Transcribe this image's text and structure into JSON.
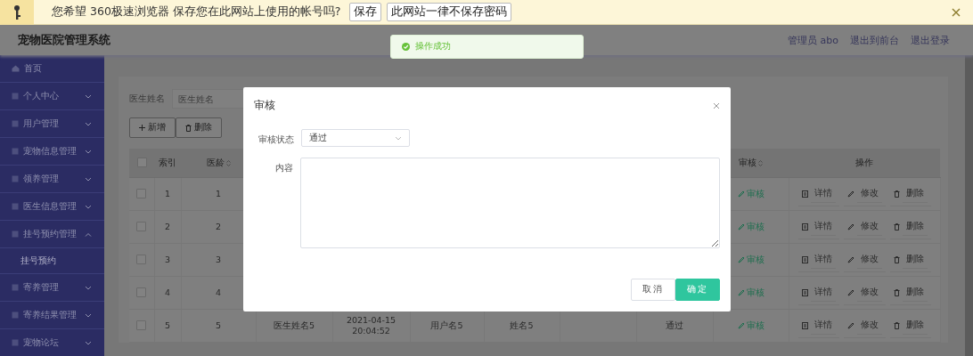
{
  "password_bar": {
    "message": "您希望 360极速浏览器 保存您在此网站上使用的帐号吗?",
    "buttons": [
      "保存",
      "此网站一律不保存密码"
    ]
  },
  "header": {
    "title": "宠物医院管理系统",
    "links": [
      "管理员 abo",
      "退出到前台",
      "退出登录"
    ]
  },
  "toast": {
    "message": "操作成功"
  },
  "sidebar": {
    "items": [
      {
        "label": "首页",
        "kind": "link"
      },
      {
        "label": "个人中心",
        "kind": "group",
        "expanded": false
      },
      {
        "label": "用户管理",
        "kind": "group",
        "expanded": false
      },
      {
        "label": "宠物信息管理",
        "kind": "group",
        "expanded": false
      },
      {
        "label": "领养管理",
        "kind": "group",
        "expanded": false
      },
      {
        "label": "医生信息管理",
        "kind": "group",
        "expanded": false
      },
      {
        "label": "挂号预约管理",
        "kind": "group",
        "expanded": true,
        "children": [
          {
            "label": "挂号预约"
          }
        ]
      },
      {
        "label": "寄养管理",
        "kind": "group",
        "expanded": false
      },
      {
        "label": "寄养结果管理",
        "kind": "group",
        "expanded": false
      },
      {
        "label": "宠物论坛",
        "kind": "group",
        "expanded": false
      }
    ]
  },
  "search": {
    "label": "医生姓名",
    "placeholder": "医生姓名"
  },
  "toolbar": [
    {
      "label": "新增",
      "kind": "add"
    },
    {
      "label": "删除",
      "kind": "delete"
    }
  ],
  "table": {
    "select_all_checked": false,
    "columns": [
      {
        "kind": "text",
        "label": "索引",
        "sortable": false
      },
      {
        "kind": "text",
        "label": "医龄",
        "sortable": true
      },
      {
        "kind": "hidden"
      },
      {
        "kind": "hidden"
      },
      {
        "kind": "hidden"
      },
      {
        "kind": "hidden"
      },
      {
        "kind": "hidden"
      },
      {
        "kind": "hidden"
      },
      {
        "kind": "text",
        "label": "审核",
        "sortable": true
      },
      {
        "kind": "text",
        "label": "操作",
        "sortable": false
      }
    ],
    "rows": [
      {
        "checked": false,
        "cells": [
          "1",
          "1",
          null,
          null,
          null,
          null,
          null,
          null
        ],
        "review": "审核",
        "actions": [
          {
            "kind": "detail",
            "label": "详情"
          },
          {
            "kind": "edit",
            "label": "修改"
          },
          {
            "kind": "delete",
            "label": "删除"
          }
        ]
      },
      {
        "checked": false,
        "cells": [
          "2",
          "2",
          null,
          null,
          null,
          null,
          null,
          null
        ],
        "review": "审核",
        "actions": [
          {
            "kind": "detail",
            "label": "详情"
          },
          {
            "kind": "edit",
            "label": "修改"
          },
          {
            "kind": "delete",
            "label": "删除"
          }
        ]
      },
      {
        "checked": false,
        "cells": [
          "3",
          "3",
          null,
          null,
          null,
          null,
          null,
          null
        ],
        "review": "审核",
        "actions": [
          {
            "kind": "detail",
            "label": "详情"
          },
          {
            "kind": "edit",
            "label": "修改"
          },
          {
            "kind": "delete",
            "label": "删除"
          }
        ]
      },
      {
        "checked": false,
        "cells": [
          "4",
          "4",
          null,
          null,
          null,
          null,
          null,
          null
        ],
        "review": "审核",
        "actions": [
          {
            "kind": "detail",
            "label": "详情"
          },
          {
            "kind": "edit",
            "label": "修改"
          },
          {
            "kind": "delete",
            "label": "删除"
          }
        ]
      },
      {
        "checked": false,
        "cells": [
          "5",
          "5",
          "医生姓名5",
          "2021-04-15 20:04:52",
          "用户名5",
          "姓名5",
          null,
          "通过"
        ],
        "review": "审核",
        "actions": [
          {
            "kind": "detail",
            "label": "详情"
          },
          {
            "kind": "edit",
            "label": "修改"
          },
          {
            "kind": "delete",
            "label": "删除"
          }
        ]
      }
    ]
  },
  "dialog": {
    "title": "审核",
    "fields": [
      {
        "kind": "select",
        "label": "审核状态",
        "value": "通过"
      },
      {
        "kind": "textarea",
        "label": "内容"
      }
    ],
    "buttons": [
      {
        "label": "取消",
        "primary": false
      },
      {
        "label": "确定",
        "primary": true
      }
    ]
  }
}
